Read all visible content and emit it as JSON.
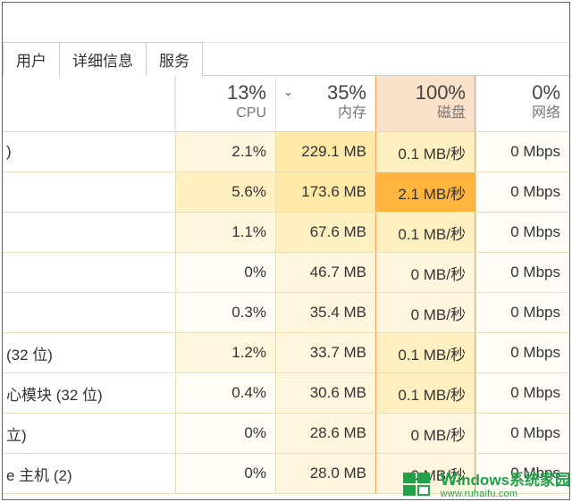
{
  "tabs": {
    "users": "用户",
    "details": "详细信息",
    "services": "服务"
  },
  "columns": {
    "cpu": {
      "pct": "13%",
      "label": "CPU"
    },
    "memory": {
      "pct": "35%",
      "label": "内存",
      "sorted": true
    },
    "disk": {
      "pct": "100%",
      "label": "磁盘"
    },
    "network": {
      "pct": "0%",
      "label": "网络"
    }
  },
  "rows": [
    {
      "name": ")",
      "cpu": "2.1%",
      "mem": "229.1 MB",
      "disk": "0.1 MB/秒",
      "net": "0 Mbps",
      "heat": {
        "cpu": "h1",
        "mem": "h3",
        "disk": "h2",
        "net": "h0"
      }
    },
    {
      "name": "",
      "cpu": "5.6%",
      "mem": "173.6 MB",
      "disk": "2.1 MB/秒",
      "net": "0 Mbps",
      "heat": {
        "cpu": "h2",
        "mem": "h3",
        "disk": "h5",
        "net": "h0"
      }
    },
    {
      "name": "",
      "cpu": "1.1%",
      "mem": "67.6 MB",
      "disk": "0.1 MB/秒",
      "net": "0 Mbps",
      "heat": {
        "cpu": "h1",
        "mem": "h2",
        "disk": "h2",
        "net": "h0"
      }
    },
    {
      "name": "",
      "cpu": "0%",
      "mem": "46.7 MB",
      "disk": "0 MB/秒",
      "net": "0 Mbps",
      "heat": {
        "cpu": "h0",
        "mem": "h1",
        "disk": "h1",
        "net": "h0"
      }
    },
    {
      "name": "",
      "cpu": "0.3%",
      "mem": "35.4 MB",
      "disk": "0 MB/秒",
      "net": "0 Mbps",
      "heat": {
        "cpu": "h0",
        "mem": "h1",
        "disk": "h1",
        "net": "h0"
      }
    },
    {
      "name": "(32 位)",
      "cpu": "1.2%",
      "mem": "33.7 MB",
      "disk": "0.1 MB/秒",
      "net": "0 Mbps",
      "heat": {
        "cpu": "h1",
        "mem": "h1",
        "disk": "h2",
        "net": "h0"
      }
    },
    {
      "name": "心模块 (32 位)",
      "cpu": "0.4%",
      "mem": "30.6 MB",
      "disk": "0.1 MB/秒",
      "net": "0 Mbps",
      "heat": {
        "cpu": "h0",
        "mem": "h1",
        "disk": "h2",
        "net": "h0"
      }
    },
    {
      "name": "立)",
      "cpu": "0%",
      "mem": "28.6 MB",
      "disk": "0 MB/秒",
      "net": "0 Mbps",
      "heat": {
        "cpu": "h0",
        "mem": "h1",
        "disk": "h1",
        "net": "h0"
      }
    },
    {
      "name": "e 主机 (2)",
      "cpu": "0%",
      "mem": "28.0 MB",
      "disk": "0 MB/秒",
      "net": "0 Mbps",
      "heat": {
        "cpu": "h0",
        "mem": "h1",
        "disk": "h1",
        "net": "h0"
      }
    }
  ],
  "watermark": {
    "line1_w": "W",
    "line1_rest": "indows系统家园",
    "line2": "www.ruhaifu.com"
  }
}
